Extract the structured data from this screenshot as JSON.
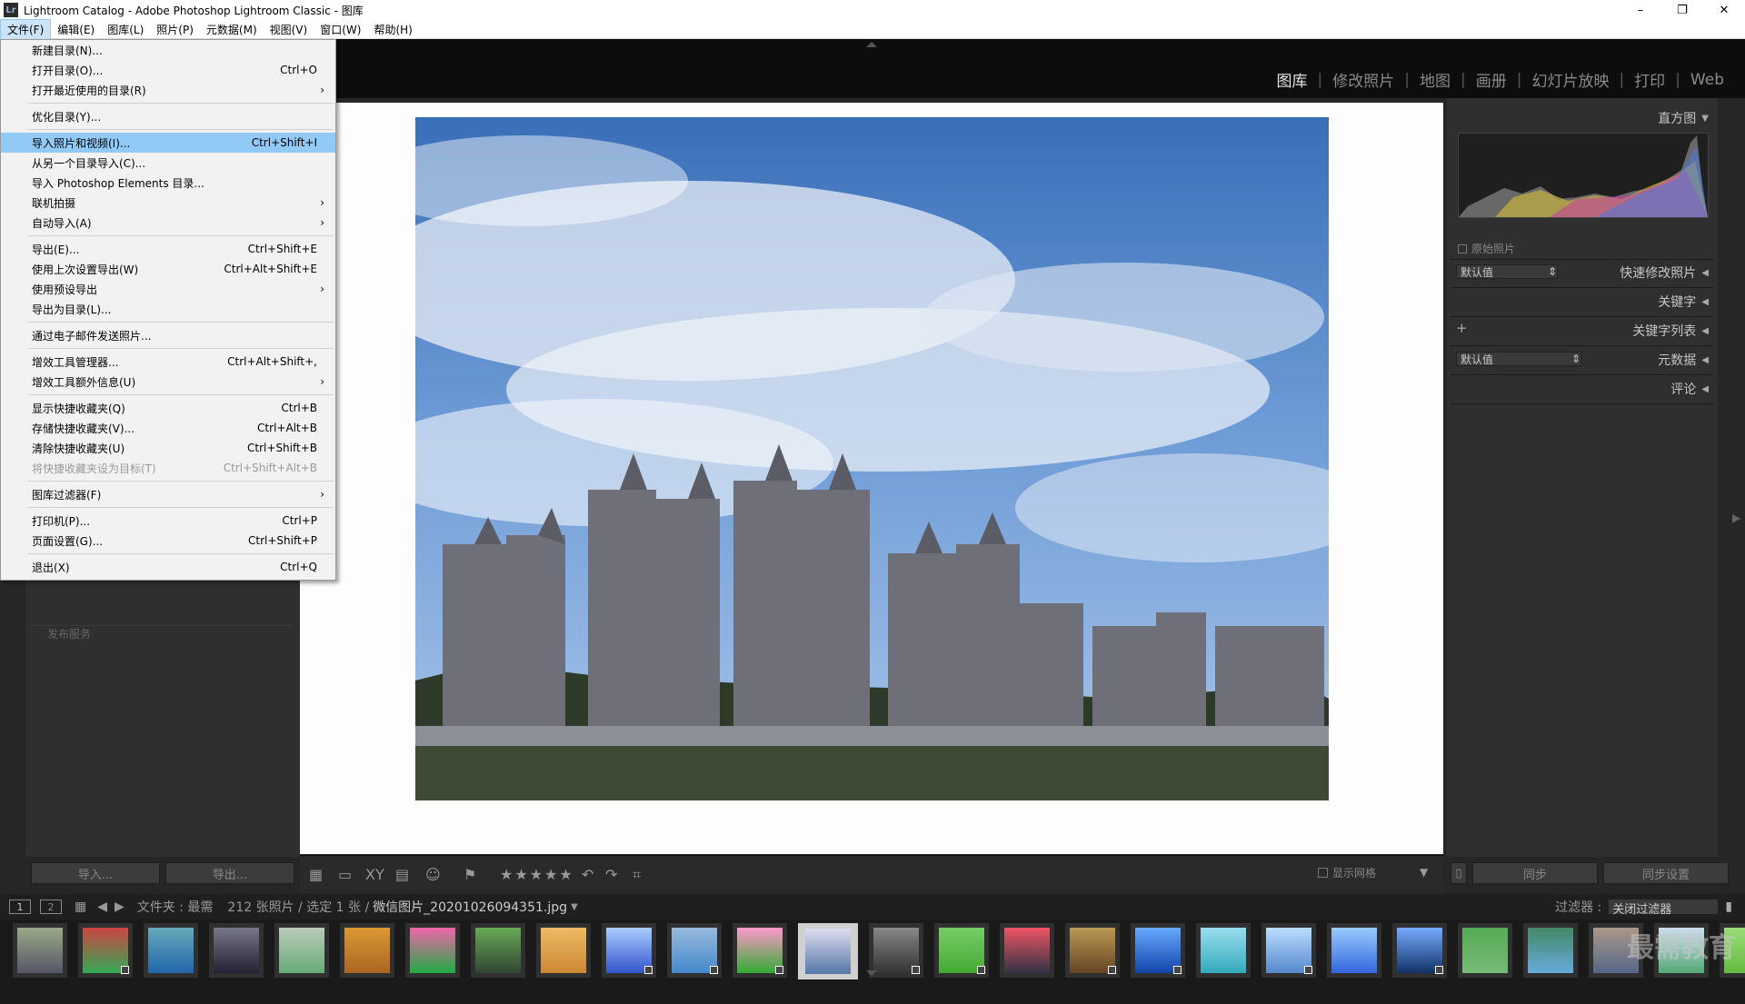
{
  "window": {
    "title": "Lightroom Catalog - Adobe Photoshop Lightroom Classic - 图库",
    "app_icon": "Lr",
    "controls": [
      "–",
      "❐",
      "✕"
    ]
  },
  "menubar": [
    "文件(F)",
    "编辑(E)",
    "图库(L)",
    "照片(P)",
    "元数据(M)",
    "视图(V)",
    "窗口(W)",
    "帮助(H)"
  ],
  "file_menu": {
    "groups": [
      [
        {
          "label": "新建目录(N)...",
          "shortcut": "",
          "submenu": false,
          "disabled": false,
          "highlighted": false
        },
        {
          "label": "打开目录(O)...",
          "shortcut": "Ctrl+O",
          "submenu": false,
          "disabled": false,
          "highlighted": false
        },
        {
          "label": "打开最近使用的目录(R)",
          "shortcut": "",
          "submenu": true,
          "disabled": false,
          "highlighted": false
        }
      ],
      [
        {
          "label": "优化目录(Y)...",
          "shortcut": "",
          "submenu": false,
          "disabled": false,
          "highlighted": false
        }
      ],
      [
        {
          "label": "导入照片和视频(I)...",
          "shortcut": "Ctrl+Shift+I",
          "submenu": false,
          "disabled": false,
          "highlighted": true
        },
        {
          "label": "从另一个目录导入(C)...",
          "shortcut": "",
          "submenu": false,
          "disabled": false,
          "highlighted": false
        },
        {
          "label": "导入 Photoshop Elements 目录...",
          "shortcut": "",
          "submenu": false,
          "disabled": false,
          "highlighted": false
        },
        {
          "label": "联机拍摄",
          "shortcut": "",
          "submenu": true,
          "disabled": false,
          "highlighted": false
        },
        {
          "label": "自动导入(A)",
          "shortcut": "",
          "submenu": true,
          "disabled": false,
          "highlighted": false
        }
      ],
      [
        {
          "label": "导出(E)...",
          "shortcut": "Ctrl+Shift+E",
          "submenu": false,
          "disabled": false,
          "highlighted": false
        },
        {
          "label": "使用上次设置导出(W)",
          "shortcut": "Ctrl+Alt+Shift+E",
          "submenu": false,
          "disabled": false,
          "highlighted": false
        },
        {
          "label": "使用预设导出",
          "shortcut": "",
          "submenu": true,
          "disabled": false,
          "highlighted": false
        },
        {
          "label": "导出为目录(L)...",
          "shortcut": "",
          "submenu": false,
          "disabled": false,
          "highlighted": false
        }
      ],
      [
        {
          "label": "通过电子邮件发送照片...",
          "shortcut": "",
          "submenu": false,
          "disabled": false,
          "highlighted": false
        }
      ],
      [
        {
          "label": "增效工具管理器...",
          "shortcut": "Ctrl+Alt+Shift+,",
          "submenu": false,
          "disabled": false,
          "highlighted": false
        },
        {
          "label": "增效工具额外信息(U)",
          "shortcut": "",
          "submenu": true,
          "disabled": false,
          "highlighted": false
        }
      ],
      [
        {
          "label": "显示快捷收藏夹(Q)",
          "shortcut": "Ctrl+B",
          "submenu": false,
          "disabled": false,
          "highlighted": false
        },
        {
          "label": "存储快捷收藏夹(V)...",
          "shortcut": "Ctrl+Alt+B",
          "submenu": false,
          "disabled": false,
          "highlighted": false
        },
        {
          "label": "清除快捷收藏夹(U)",
          "shortcut": "Ctrl+Shift+B",
          "submenu": false,
          "disabled": false,
          "highlighted": false
        },
        {
          "label": "将快捷收藏夹设为目标(T)",
          "shortcut": "Ctrl+Shift+Alt+B",
          "submenu": false,
          "disabled": true,
          "highlighted": false
        }
      ],
      [
        {
          "label": "图库过滤器(F)",
          "shortcut": "",
          "submenu": true,
          "disabled": false,
          "highlighted": false
        }
      ],
      [
        {
          "label": "打印机(P)...",
          "shortcut": "Ctrl+P",
          "submenu": false,
          "disabled": false,
          "highlighted": false
        },
        {
          "label": "页面设置(G)...",
          "shortcut": "Ctrl+Shift+P",
          "submenu": false,
          "disabled": false,
          "highlighted": false
        }
      ],
      [
        {
          "label": "退出(X)",
          "shortcut": "Ctrl+Q",
          "submenu": false,
          "disabled": false,
          "highlighted": false
        }
      ]
    ]
  },
  "modules": [
    {
      "label": "图库",
      "active": true
    },
    {
      "label": "修改照片",
      "active": false
    },
    {
      "label": "地图",
      "active": false
    },
    {
      "label": "画册",
      "active": false
    },
    {
      "label": "幻灯片放映",
      "active": false
    },
    {
      "label": "打印",
      "active": false
    },
    {
      "label": "Web",
      "active": false
    }
  ],
  "left_panel": {
    "publish_label": "发布服务",
    "import_button": "导入...",
    "export_button": "导出..."
  },
  "right_panel": {
    "histogram": "直方图",
    "original_photo": "原始照片",
    "quick_develop": "快速修改照片",
    "keywording": "关键字",
    "keyword_list": "关键字列表",
    "metadata": "元数据",
    "comments": "评论",
    "preset_value": "默认值",
    "metadata_preset_value": "默认值",
    "sync_button": "同步",
    "sync_settings_button": "同步设置"
  },
  "toolbar": {
    "show_grid_label": "显示网格",
    "stars": "★★★★★"
  },
  "filmstrip_bar": {
    "page1": "1",
    "page2": "2",
    "folder_label": "文件夹 : 最需",
    "count_text": "212 张照片 / 选定 1 张 /",
    "filename": "微信图片_20201026094351.jpg",
    "filter_label": "过滤器 :",
    "filter_value": "关闭过滤器"
  },
  "watermark": "最需教育",
  "colors": {
    "accent_highlight": "#91c9f7",
    "panel_bg": "#2f2f2f",
    "viewer_bg": "#fdfdfd"
  }
}
